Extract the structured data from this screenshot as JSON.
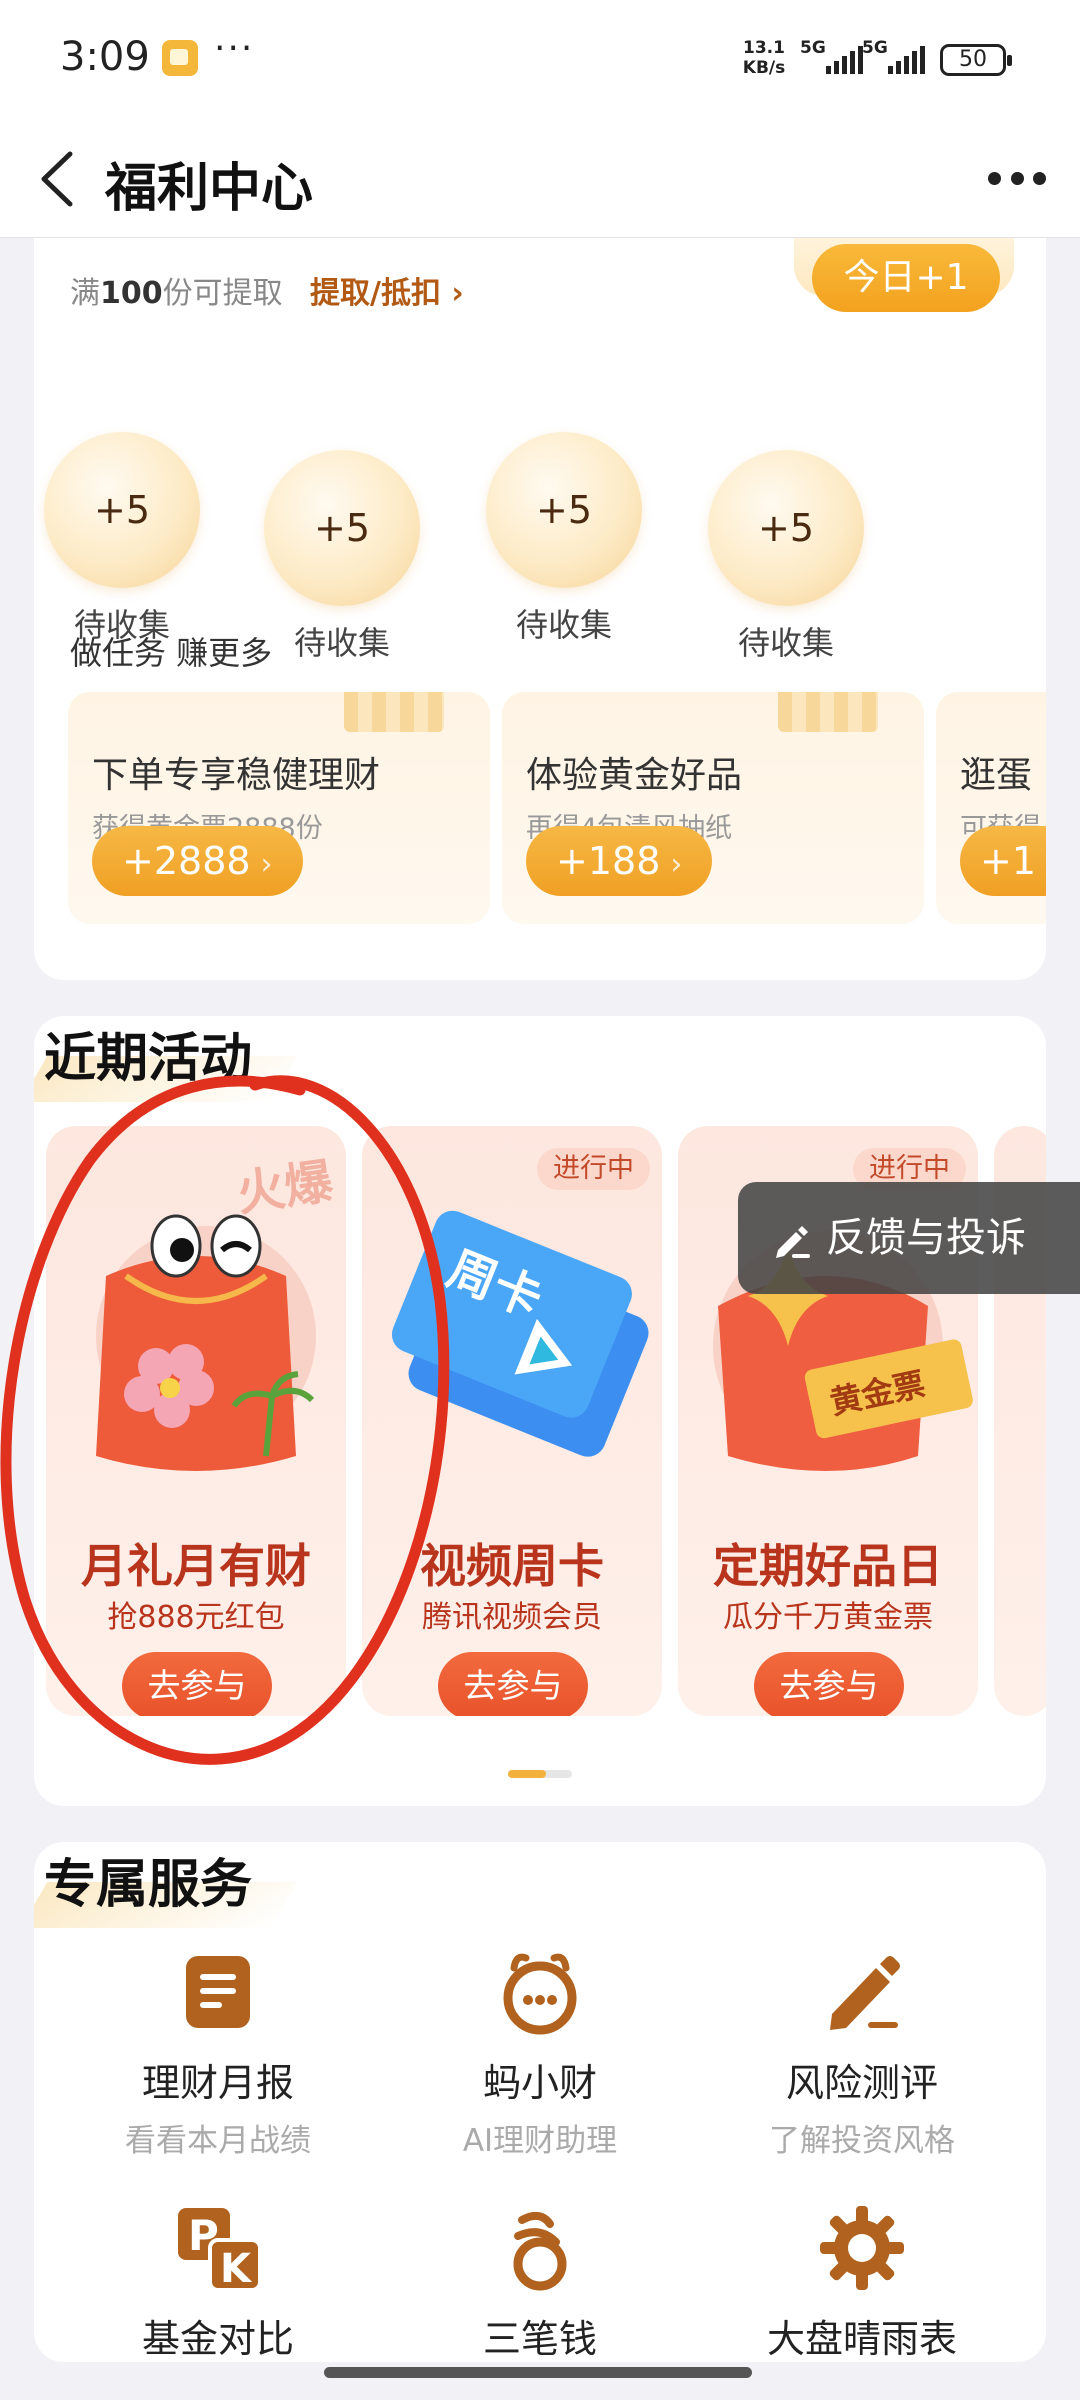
{
  "status_bar": {
    "time": "3:09",
    "more": "···",
    "speed": "13.1 KB/s",
    "network1": "5G",
    "network2": "5G",
    "battery": "50"
  },
  "header": {
    "title": "福利中心"
  },
  "coins": {
    "withdraw_prefix": "满",
    "withdraw_amount": "100",
    "withdraw_suffix": "份可提取",
    "withdraw_link": "提取/抵扣 ›",
    "today_badge": "今日+1",
    "items": [
      {
        "value": "+5",
        "label": "待收集"
      },
      {
        "value": "+5",
        "label": "待收集"
      },
      {
        "value": "+5",
        "label": "待收集"
      },
      {
        "value": "+5",
        "label": "待收集"
      }
    ]
  },
  "tasks": {
    "title": "做任务 赚更多",
    "items": [
      {
        "name": "下单专享稳健理财",
        "sub": "获得黄金票2888份",
        "reward": "+2888"
      },
      {
        "name": "体验黄金好品",
        "sub": "再得4包清风抽纸",
        "reward": "+188"
      },
      {
        "name": "逛蛋",
        "sub": "可获得",
        "reward": "+1"
      }
    ]
  },
  "activities": {
    "title": "近期活动",
    "items": [
      {
        "name": "月礼月有财",
        "sub": "抢888元红包",
        "button": "去参与",
        "badge": "火爆"
      },
      {
        "name": "视频周卡",
        "sub": "腾讯视频会员",
        "button": "去参与",
        "status": "进行中",
        "art_text": "周卡"
      },
      {
        "name": "定期好品日",
        "sub": "瓜分千万黄金票",
        "button": "去参与",
        "status": "进行中",
        "art_text": "黄金票"
      }
    ]
  },
  "services": {
    "title": "专属服务",
    "items": [
      {
        "name": "理财月报",
        "sub": "看看本月战绩",
        "icon": "report-icon"
      },
      {
        "name": "蚂小财",
        "sub": "AI理财助理",
        "icon": "ai-assistant-icon"
      },
      {
        "name": "风险测评",
        "sub": "了解投资风格",
        "icon": "pen-icon"
      },
      {
        "name": "基金对比",
        "sub": "",
        "icon": "pk-icon"
      },
      {
        "name": "三笔钱",
        "sub": "",
        "icon": "three-money-icon"
      },
      {
        "name": "大盘晴雨表",
        "sub": "",
        "icon": "gear-sun-icon"
      }
    ]
  },
  "feedback": {
    "label": "反馈与投诉"
  },
  "colors": {
    "accent_gold": "#f3a21f",
    "activity_red": "#b8341c",
    "button_red": "#e8522a",
    "icon_brown": "#b0621e",
    "annotation_red": "#e0301e"
  }
}
